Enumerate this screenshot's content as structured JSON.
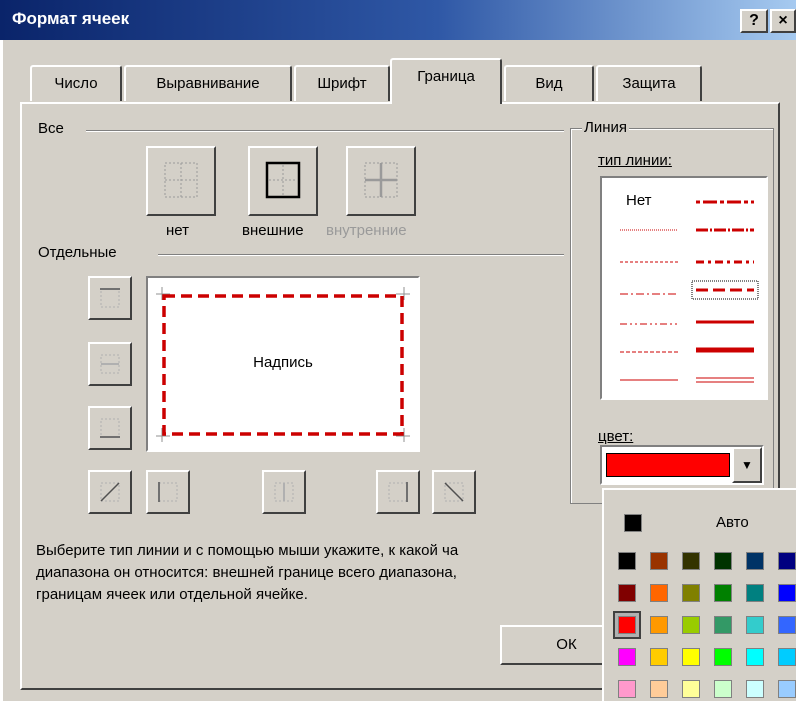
{
  "window": {
    "title": "Формат ячеек",
    "help_label": "?",
    "close_label": "×"
  },
  "tabs": [
    {
      "label": "Число",
      "active": false
    },
    {
      "label": "Выравнивание",
      "active": false
    },
    {
      "label": "Шрифт",
      "active": false
    },
    {
      "label": "Граница",
      "active": true
    },
    {
      "label": "Вид",
      "active": false
    },
    {
      "label": "Защита",
      "active": false
    }
  ],
  "presets": {
    "group_label": "Все",
    "none_label": "нет",
    "outline_label": "внешние",
    "inside_label": "внутренние"
  },
  "borders": {
    "group_label": "Отдельные",
    "preview_text": "Надпись",
    "border_color": "#cc0000"
  },
  "line": {
    "group_label": "Линия",
    "style_label": "тип линии:",
    "none_style_label": "Нет",
    "color_label": "цвет:",
    "selected_color": "#ff0000"
  },
  "palette": {
    "auto_label": "Авто",
    "auto_color": "#000000",
    "rows": [
      [
        "#000000",
        "#993300",
        "#333300",
        "#003300",
        "#003366",
        "#000080"
      ],
      [
        "#800000",
        "#ff6600",
        "#808000",
        "#008000",
        "#008080",
        "#0000ff"
      ],
      [
        "#ff0000",
        "#ff9900",
        "#99cc00",
        "#339966",
        "#33cccc",
        "#3366ff"
      ],
      [
        "#ff00ff",
        "#ffcc00",
        "#ffff00",
        "#00ff00",
        "#00ffff",
        "#00ccff"
      ],
      [
        "#ff99cc",
        "#ffcc99",
        "#ffff99",
        "#ccffcc",
        "#ccffff",
        "#99ccff"
      ]
    ],
    "selected": "#ff0000"
  },
  "help_text": {
    "line1": "Выберите тип линии и с помощью мыши укажите, к какой ча",
    "line2": "диапазона он относится: внешней границе всего диапазона,",
    "line3": "границам ячеек или отдельной ячейке."
  },
  "buttons": {
    "ok_label": "ОК"
  }
}
